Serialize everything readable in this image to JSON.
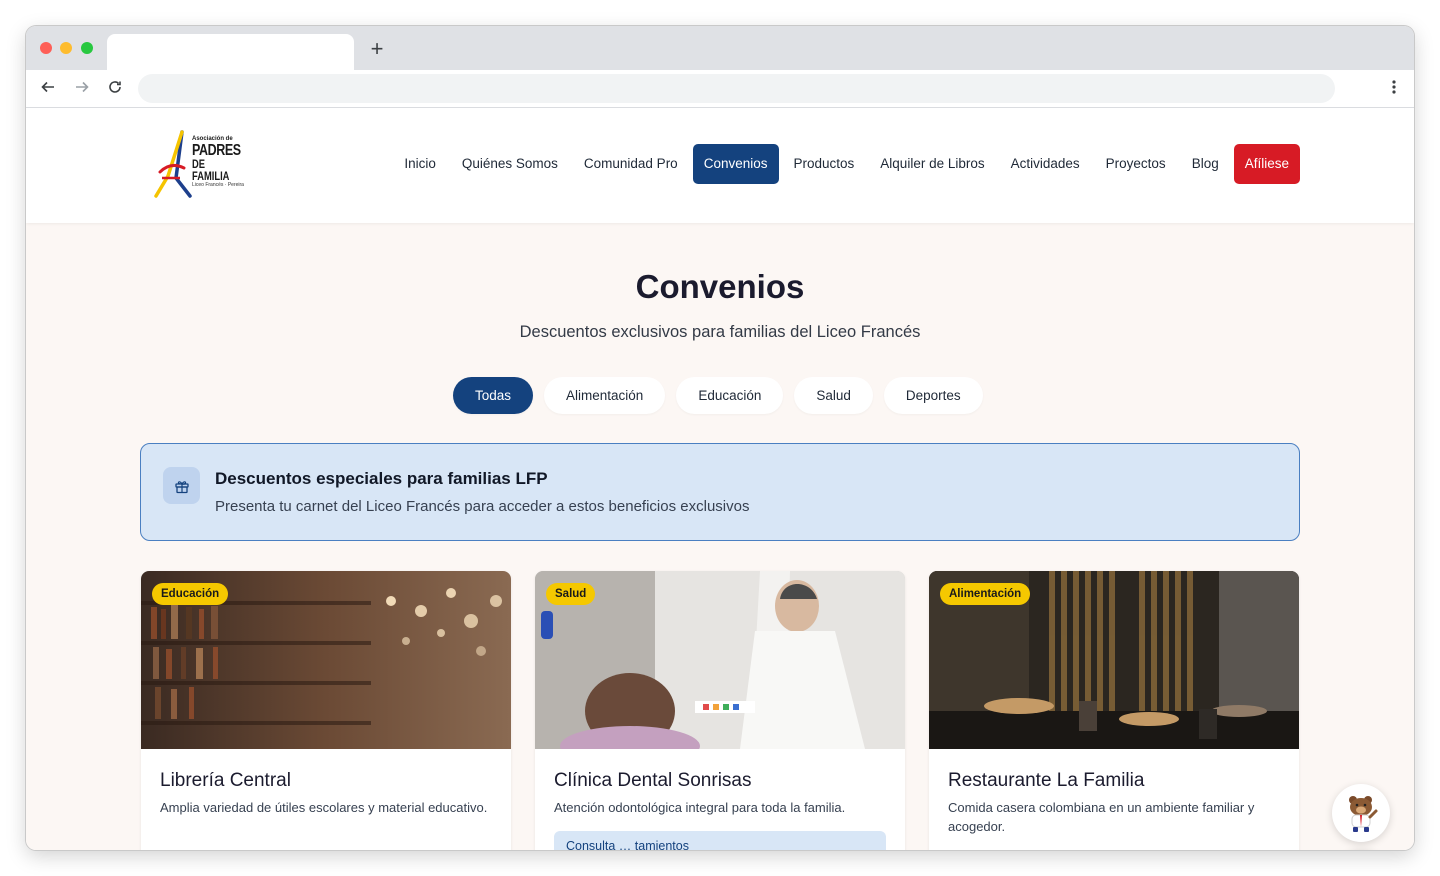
{
  "browser": {
    "tab_title": "",
    "new_tab_label": "+",
    "back_icon": "arrow-left-icon",
    "forward_icon": "arrow-right-icon",
    "reload_icon": "reload-icon",
    "menu_icon": "kebab-icon"
  },
  "logo": {
    "line1": "Asociación de",
    "line2": "PADRES",
    "line3": "DE FAMILIA",
    "line4": "Liceo Francés · Pereira"
  },
  "nav": {
    "items": [
      "Inicio",
      "Quiénes Somos",
      "Comunidad Pro",
      "Convenios",
      "Productos",
      "Alquiler de Libros",
      "Actividades",
      "Proyectos",
      "Blog"
    ],
    "active": "Convenios",
    "cta": "Afíliese"
  },
  "hero": {
    "title": "Convenios",
    "subtitle": "Descuentos exclusivos para familias del Liceo Francés"
  },
  "filters": {
    "items": [
      "Todas",
      "Alimentación",
      "Educación",
      "Salud",
      "Deportes"
    ],
    "active": "Todas"
  },
  "banner": {
    "icon": "gift-icon",
    "title": "Descuentos especiales para familias LFP",
    "text": "Presenta tu carnet del Liceo Francés para acceder a estos beneficios exclusivos"
  },
  "cards": [
    {
      "badge": "Educación",
      "title": "Librería Central",
      "description": "Amplia variedad de útiles escolares y material educativo.",
      "pill": ""
    },
    {
      "badge": "Salud",
      "title": "Clínica Dental Sonrisas",
      "description": "Atención odontológica integral para toda la familia.",
      "pill": "Consulta … tamientos"
    },
    {
      "badge": "Alimentación",
      "title": "Restaurante La Familia",
      "description": "Comida casera colombiana en un ambiente familiar y acogedor.",
      "pill": ""
    }
  ],
  "colors": {
    "primary": "#14427e",
    "cta": "#d71b25",
    "badge": "#f5c800",
    "chat": "#23c55e",
    "page_bg": "#fcf7f4"
  }
}
